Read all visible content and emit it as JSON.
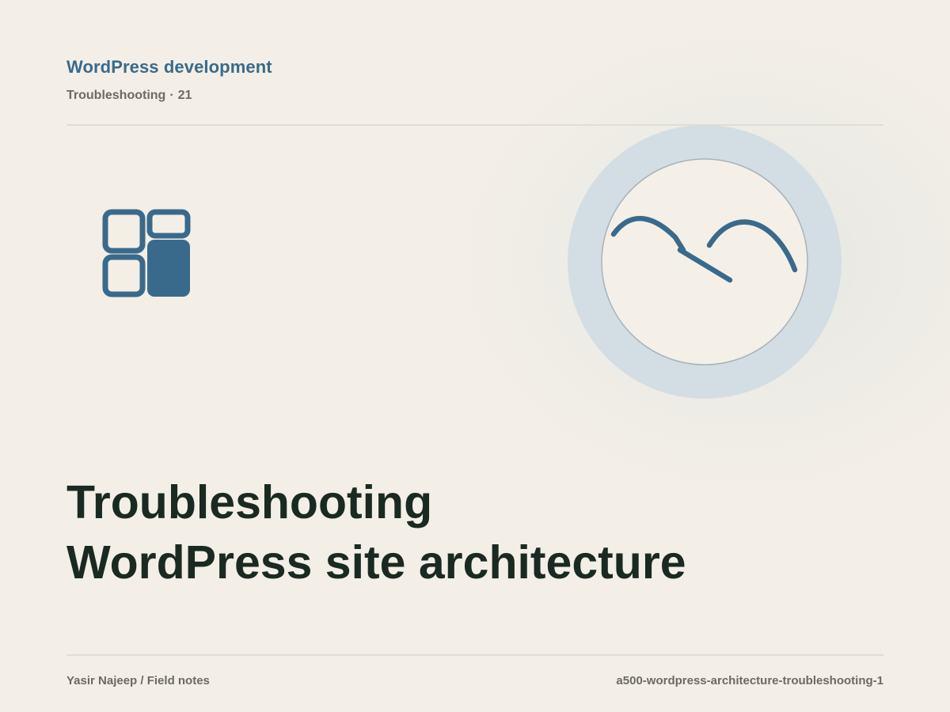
{
  "header": {
    "kicker": "WordPress development",
    "section": "Troubleshooting",
    "separator": "·",
    "number": "21"
  },
  "title": {
    "line1": "Troubleshooting",
    "line2": "WordPress site architecture"
  },
  "footer": {
    "author": "Yasir Najeep / Field notes",
    "slug": "a500-wordpress-architecture-troubleshooting-1"
  },
  "icons": {
    "layout": "layout-grid-icon",
    "illustration": "landscape-waves-icon"
  },
  "colors": {
    "background": "#f3efe7",
    "accent": "#3a6a8b",
    "halo": "#d2dee3",
    "title": "#1a2a22",
    "muted": "#6b6a63",
    "rule": "#e0ddd4"
  }
}
